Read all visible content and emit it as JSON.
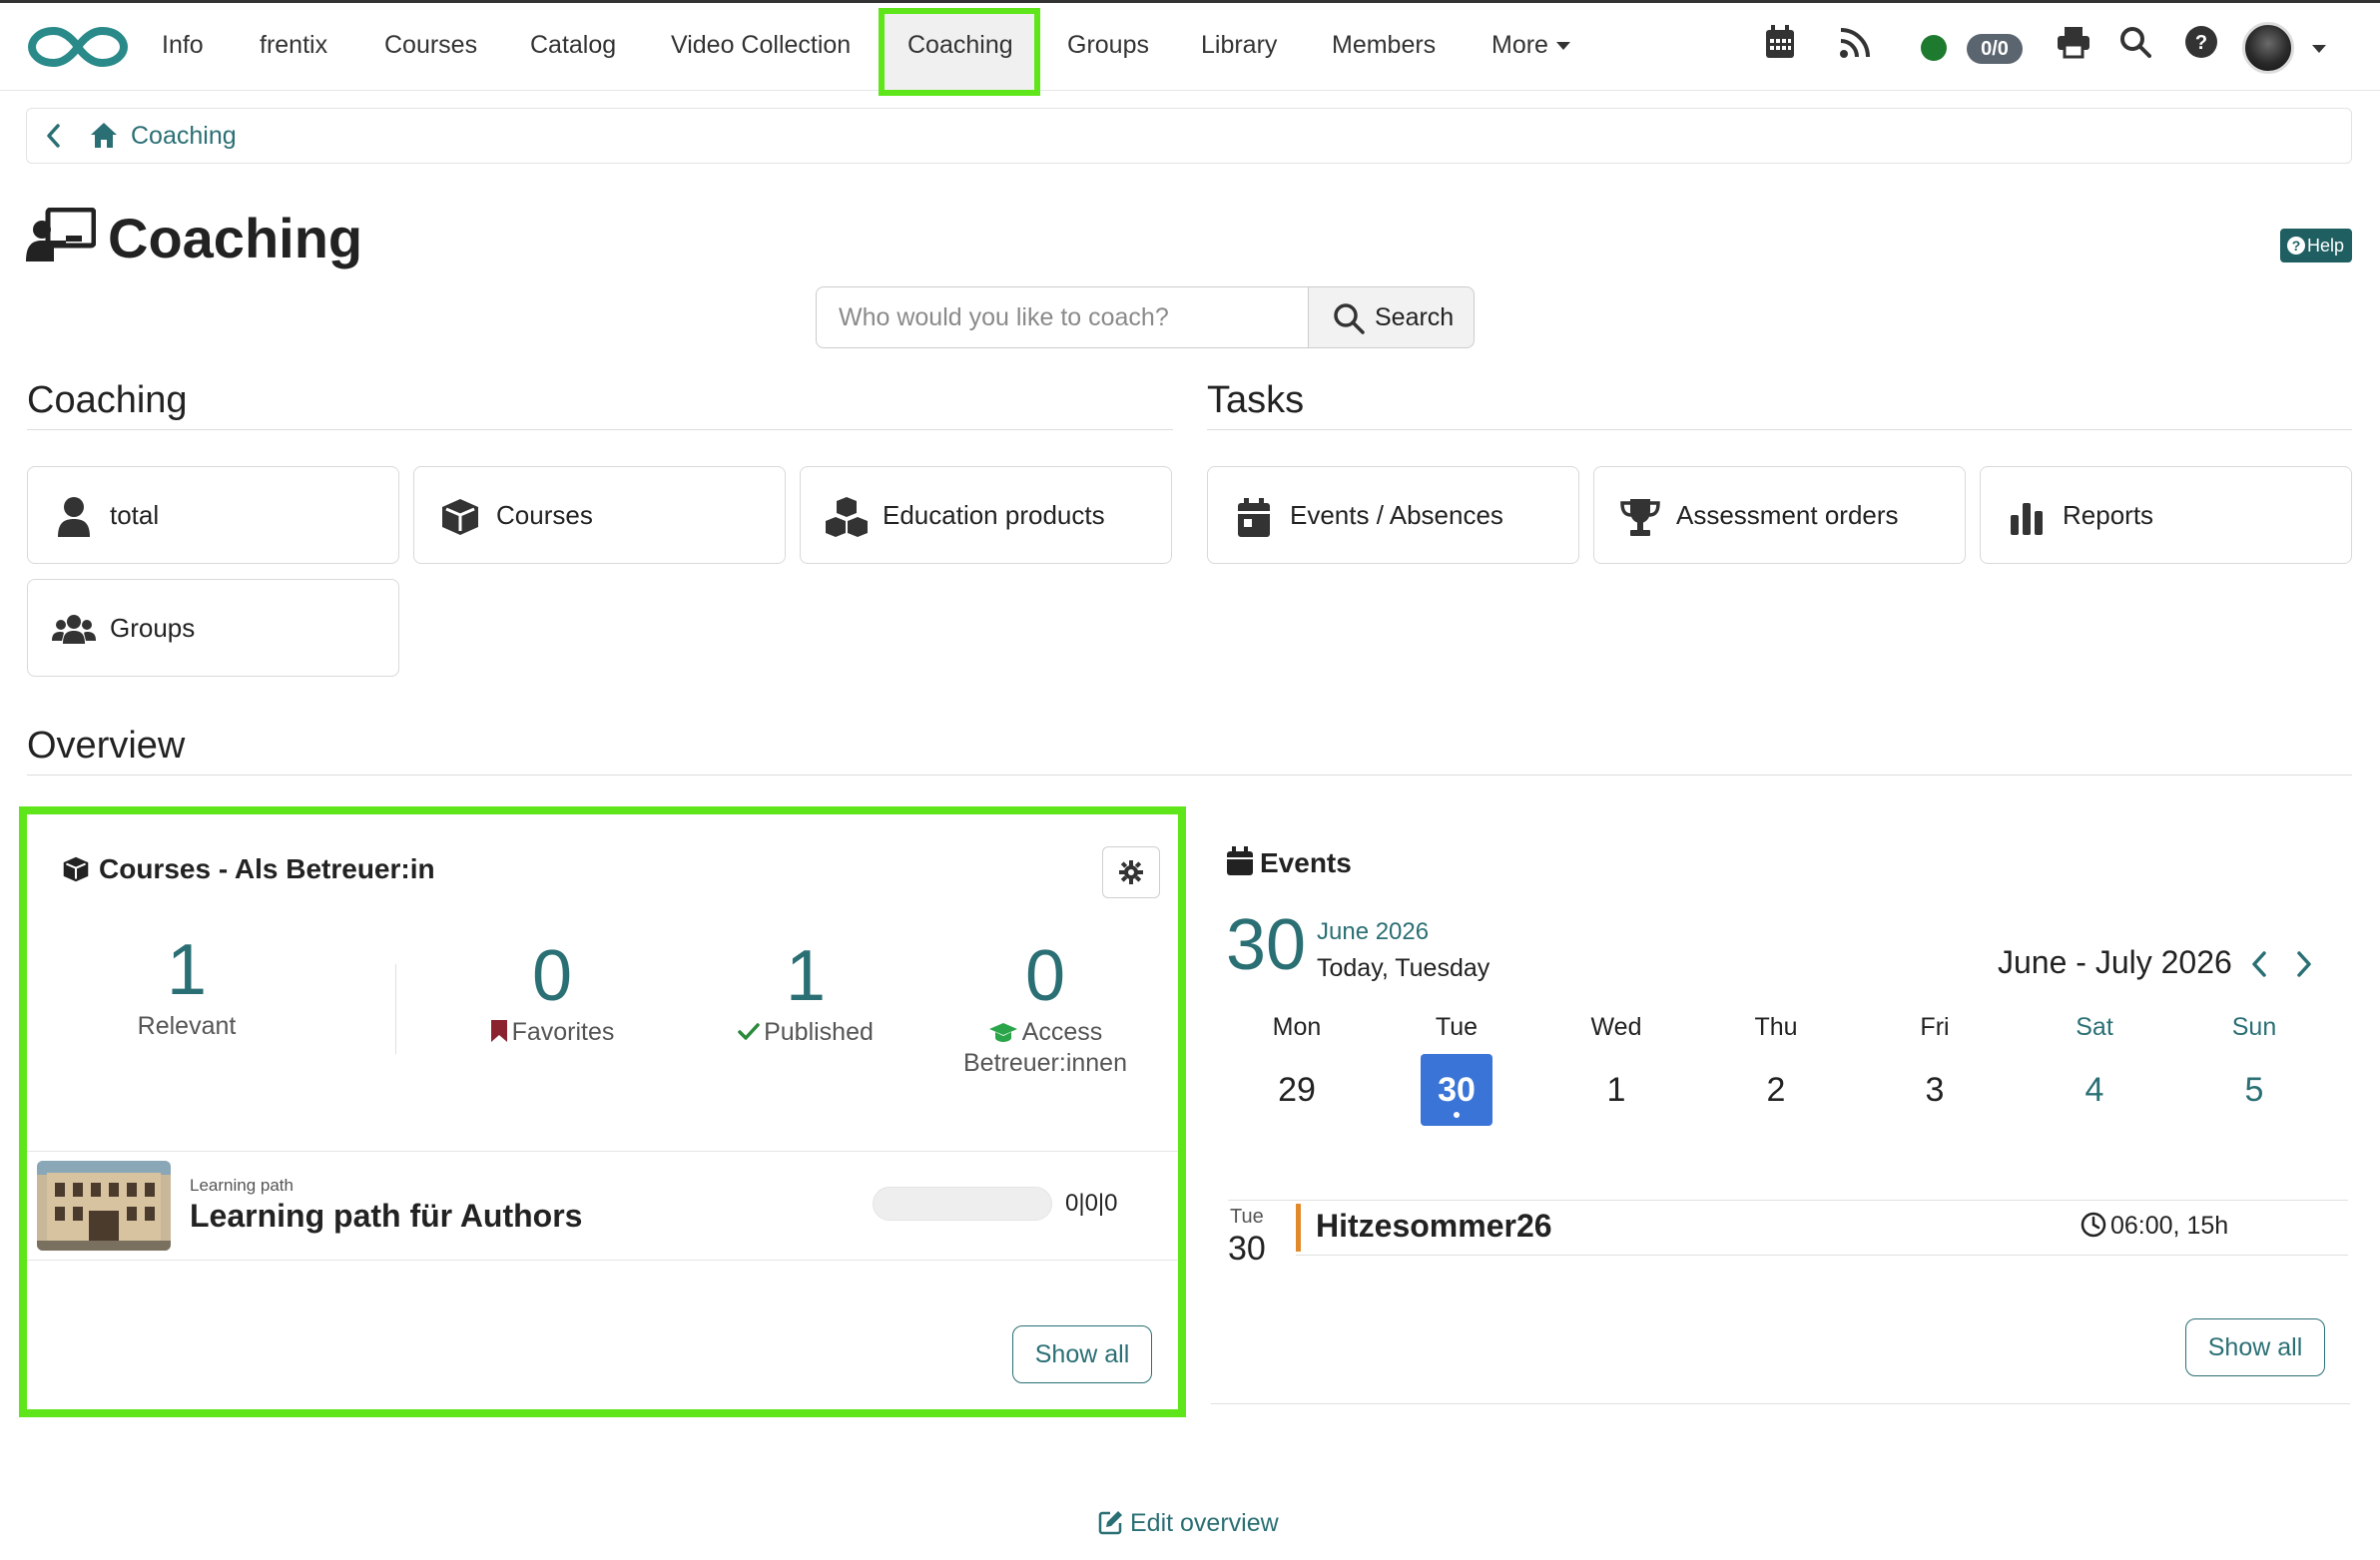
{
  "nav": {
    "items": [
      "Info",
      "frentix",
      "Courses",
      "Catalog",
      "Video Collection",
      "Coaching",
      "Groups",
      "Library",
      "Members",
      "More"
    ],
    "active": "Coaching",
    "counter": "0/0"
  },
  "breadcrumb": {
    "label": "Coaching"
  },
  "page": {
    "title": "Coaching",
    "help_label": "Help"
  },
  "search": {
    "placeholder": "Who would you like to coach?",
    "button_label": "Search"
  },
  "coaching_section": {
    "heading": "Coaching",
    "tiles": [
      {
        "label": "total",
        "icon": "user-icon"
      },
      {
        "label": "Courses",
        "icon": "cube-icon"
      },
      {
        "label": "Education products",
        "icon": "cubes-icon"
      },
      {
        "label": "Groups",
        "icon": "users-icon"
      }
    ]
  },
  "tasks_section": {
    "heading": "Tasks",
    "tiles": [
      {
        "label": "Events / Absences",
        "icon": "calendar-icon"
      },
      {
        "label": "Assessment orders",
        "icon": "trophy-icon"
      },
      {
        "label": "Reports",
        "icon": "bar-chart-icon"
      }
    ]
  },
  "overview": {
    "heading": "Overview",
    "courses_panel": {
      "title": "Courses - Als Betreuer:in",
      "stats": [
        {
          "value": "1",
          "label": "Relevant"
        },
        {
          "value": "0",
          "label": "Favorites"
        },
        {
          "value": "1",
          "label": "Published"
        },
        {
          "value": "0",
          "label": "Access",
          "label2": "Betreuer:innen"
        }
      ],
      "row": {
        "type": "Learning path",
        "title": "Learning path für Authors",
        "progress_text": "0|0|0",
        "progress_fraction": 0
      },
      "show_all": "Show all"
    },
    "events_panel": {
      "title": "Events",
      "big_day": "30",
      "month_year": "June 2026",
      "today_label": "Today, Tuesday",
      "range_label": "June - July 2026",
      "weekdays": [
        "Mon",
        "Tue",
        "Wed",
        "Thu",
        "Fri",
        "Sat",
        "Sun"
      ],
      "days": [
        "29",
        "30",
        "1",
        "2",
        "3",
        "4",
        "5"
      ],
      "today_index": 1,
      "event": {
        "dow": "Tue",
        "day": "30",
        "title": "Hitzesommer26",
        "time": "06:00, 15h"
      },
      "show_all": "Show all"
    },
    "edit_label": "Edit overview"
  },
  "colors": {
    "accent": "#2a6f74",
    "highlight": "#5ee61a",
    "today": "#3b74d7",
    "event_bar": "#e08a2c"
  }
}
